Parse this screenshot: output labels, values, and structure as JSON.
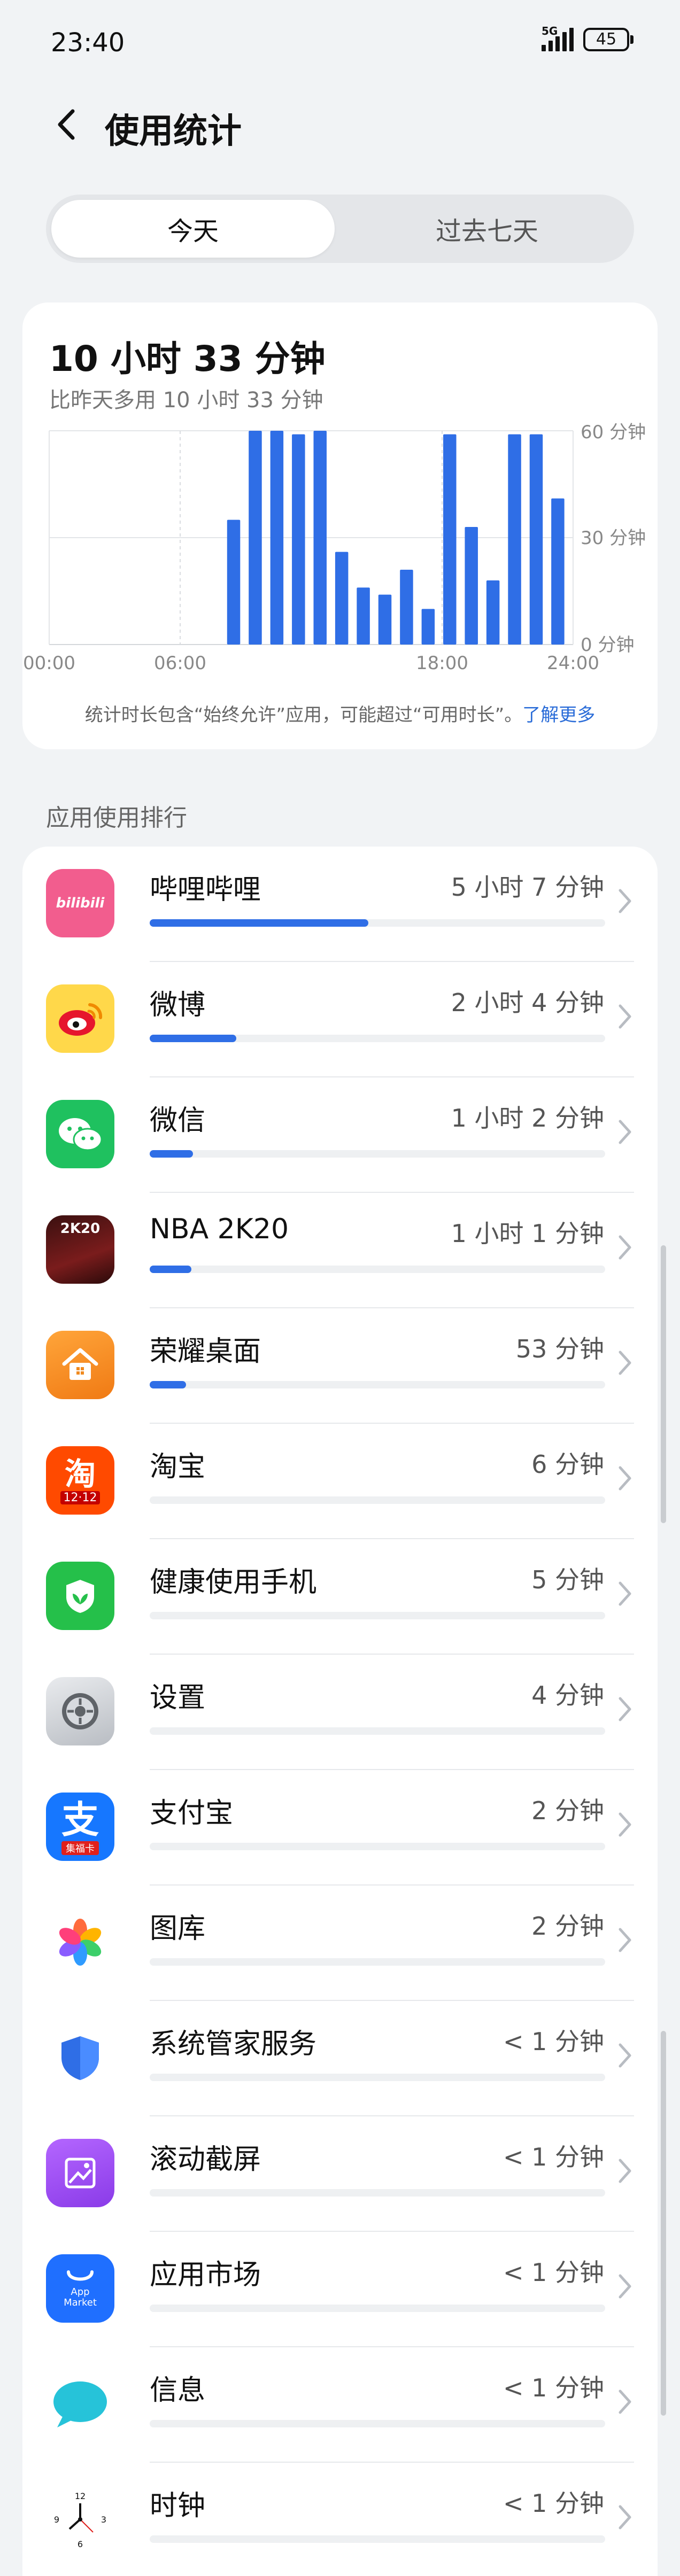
{
  "status_bar": {
    "time": "23:40",
    "network": "5G",
    "battery": "45"
  },
  "header": {
    "title": "使用统计"
  },
  "tabs": {
    "today": "今天",
    "past_week": "过去七天"
  },
  "summary": {
    "total": "10 小时 33 分钟",
    "compare": "比昨天多用 10 小时 33 分钟"
  },
  "chart_data": {
    "type": "bar",
    "x_ticks": [
      "00:00",
      "06:00",
      "18:00",
      "24:00"
    ],
    "y_ticks": [
      "60 分钟",
      "30 分钟",
      "0 分钟"
    ],
    "ylim": [
      0,
      60
    ],
    "grid": true,
    "bar_color": "#2f6ee6",
    "hours": [
      9,
      10,
      11,
      12,
      13,
      14,
      15,
      16,
      17,
      18,
      19,
      20,
      21,
      22,
      23
    ],
    "values": [
      35,
      60,
      60,
      59,
      60,
      26,
      16,
      14,
      21,
      10,
      59,
      33,
      18,
      59,
      59,
      41
    ]
  },
  "footnote": {
    "text": "统计时长包含“始终允许”应用，可能超过“可用时长”。",
    "link": "了解更多"
  },
  "section_title": "应用使用排行",
  "apps": [
    {
      "name": "哔哩哔哩",
      "time": "5 小时 7 分钟",
      "fraction": 0.48,
      "icon": "bilibili-icon"
    },
    {
      "name": "微博",
      "time": "2 小时 4 分钟",
      "fraction": 0.19,
      "icon": "weibo-icon"
    },
    {
      "name": "微信",
      "time": "1 小时 2 分钟",
      "fraction": 0.095,
      "icon": "wechat-icon"
    },
    {
      "name": "NBA 2K20",
      "time": "1 小时 1 分钟",
      "fraction": 0.092,
      "icon": "nba2k20-icon"
    },
    {
      "name": "荣耀桌面",
      "time": "53 分钟",
      "fraction": 0.08,
      "icon": "honor-launcher-icon"
    },
    {
      "name": "淘宝",
      "time": "6 分钟",
      "fraction": 0.0,
      "icon": "taobao-icon"
    },
    {
      "name": "健康使用手机",
      "time": "5 分钟",
      "fraction": 0.0,
      "icon": "digital-balance-icon"
    },
    {
      "name": "设置",
      "time": "4 分钟",
      "fraction": 0.0,
      "icon": "settings-icon"
    },
    {
      "name": "支付宝",
      "time": "2 分钟",
      "fraction": 0.0,
      "icon": "alipay-icon"
    },
    {
      "name": "图库",
      "time": "2 分钟",
      "fraction": 0.0,
      "icon": "gallery-icon"
    },
    {
      "name": "系统管家服务",
      "time": "< 1 分钟",
      "fraction": 0.0,
      "icon": "system-manager-icon"
    },
    {
      "name": "滚动截屏",
      "time": "< 1 分钟",
      "fraction": 0.0,
      "icon": "scroll-screenshot-icon"
    },
    {
      "name": "应用市场",
      "time": "< 1 分钟",
      "fraction": 0.0,
      "icon": "app-market-icon"
    },
    {
      "name": "信息",
      "time": "< 1 分钟",
      "fraction": 0.0,
      "icon": "messages-icon"
    },
    {
      "name": "时钟",
      "time": "< 1 分钟",
      "fraction": 0.0,
      "icon": "clock-icon"
    }
  ],
  "icon_text": {
    "bilibili": "bilibili",
    "taobao_top": "淘",
    "taobao_bottom": "12·12",
    "alipay_badge": "集福卡",
    "app_market": "App\nMarket",
    "nba": "2K20"
  }
}
